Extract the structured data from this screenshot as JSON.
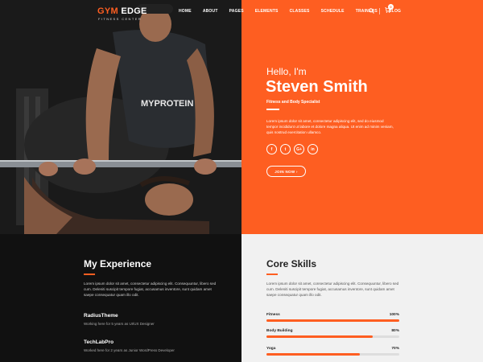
{
  "brand": {
    "name_accent": "GYM",
    "name_rest": " EDGE",
    "tagline": "FITNESS CENTER"
  },
  "nav": {
    "items": [
      "HOME",
      "ABOUT",
      "PAGES",
      "ELEMENTS",
      "CLASSES",
      "SCHEDULE",
      "TRAINERS",
      "BLOG"
    ],
    "cart_count": "0"
  },
  "hero": {
    "greeting": "Hello, I'm",
    "name": "Steven Smith",
    "role": "Fitness and Body Specialist",
    "description": "Lorem ipsum dolor sit amet, consectetur adipiscing elit, sed do eiusmod tempor incididunt ut labore et dolore magna aliqua. Ut enim ad minim veniam, quis nostrud exercitation ullamco.",
    "socials": [
      "f",
      "t",
      "G+",
      "in"
    ],
    "cta_label": "JOIN NOW  ›",
    "shirt_text": "MYPROTEIN"
  },
  "experience": {
    "title": "My Experience",
    "description": "Lorem ipsum dolor sit amet, consectetur adipiscing elit. Consequuntur, libero sed cum. Deleniti suscipit tempore fugiat, accusamus inventore, sunt quidam amet saepe consequatur quam illo odit.",
    "jobs": [
      {
        "company": "RadiusTheme",
        "detail": "Working here for 5 years as UI/UX Designer"
      },
      {
        "company": "TechLabPro",
        "detail": "Worked here for 2 years as Junior WordPress Developer"
      }
    ]
  },
  "skills": {
    "title": "Core Skills",
    "description": "Lorem ipsum dolor sit amet, consectetur adipiscing elit. Consequuntur, libero sed cum. Deleniti suscipit tempore fugiat, accusamus inventore, sunt quidam amet saepe consequatur quam illo odit.",
    "items": [
      {
        "name": "Fitness",
        "percent_label": "100%",
        "level": 1.0
      },
      {
        "name": "Body Building",
        "percent_label": "80%",
        "level": 0.8
      },
      {
        "name": "Yoga",
        "percent_label": "70%",
        "level": 0.7
      }
    ]
  },
  "colors": {
    "accent": "#fe5e21",
    "dark": "#111111",
    "light": "#f1f1f1"
  }
}
